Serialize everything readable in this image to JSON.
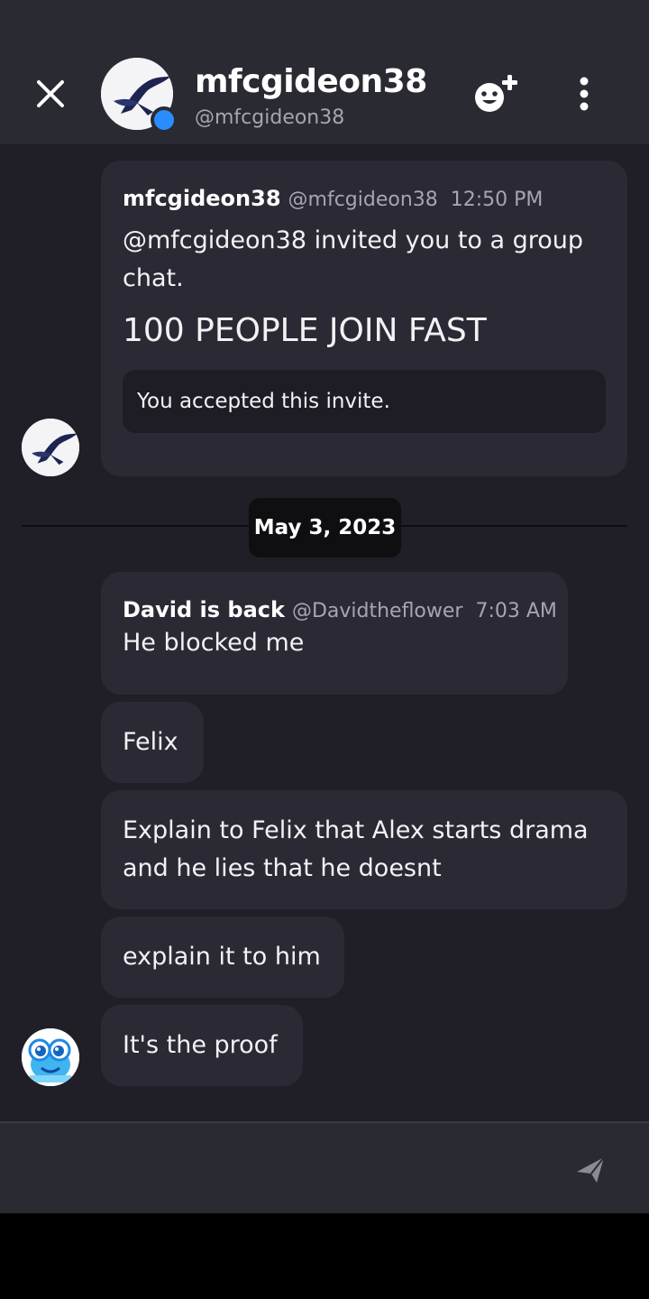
{
  "header": {
    "name": "mfcgideon38",
    "handle": "@mfcgideon38",
    "close_icon": "close-icon",
    "add_friend_icon": "emoji-plus-icon",
    "more_icon": "more-vertical-icon",
    "status_color": "#2b8cff"
  },
  "messages": {
    "invite": {
      "author": "mfcgideon38",
      "handle": "@mfcgideon38",
      "time": "12:50 PM",
      "text": "@mfcgideon38 invited you to a group chat.",
      "group_name": "100 PEOPLE JOIN FAST",
      "status": "You accepted this invite."
    },
    "date_divider": "May 3, 2023",
    "david": {
      "author": "David is back",
      "handle": "@Davidtheflower",
      "time": "7:03 AM",
      "m1": "He blocked me",
      "m2": "Felix",
      "m3": "Explain to Felix that Alex starts drama and he lies that he doesnt",
      "m4": "explain it to him",
      "m5": "It's the proof"
    }
  },
  "composer": {
    "send_icon": "send-icon"
  },
  "colors": {
    "background": "#201f27",
    "bubble": "#2b2a34",
    "header": "#2a2a33",
    "accent": "#2b8cff"
  }
}
